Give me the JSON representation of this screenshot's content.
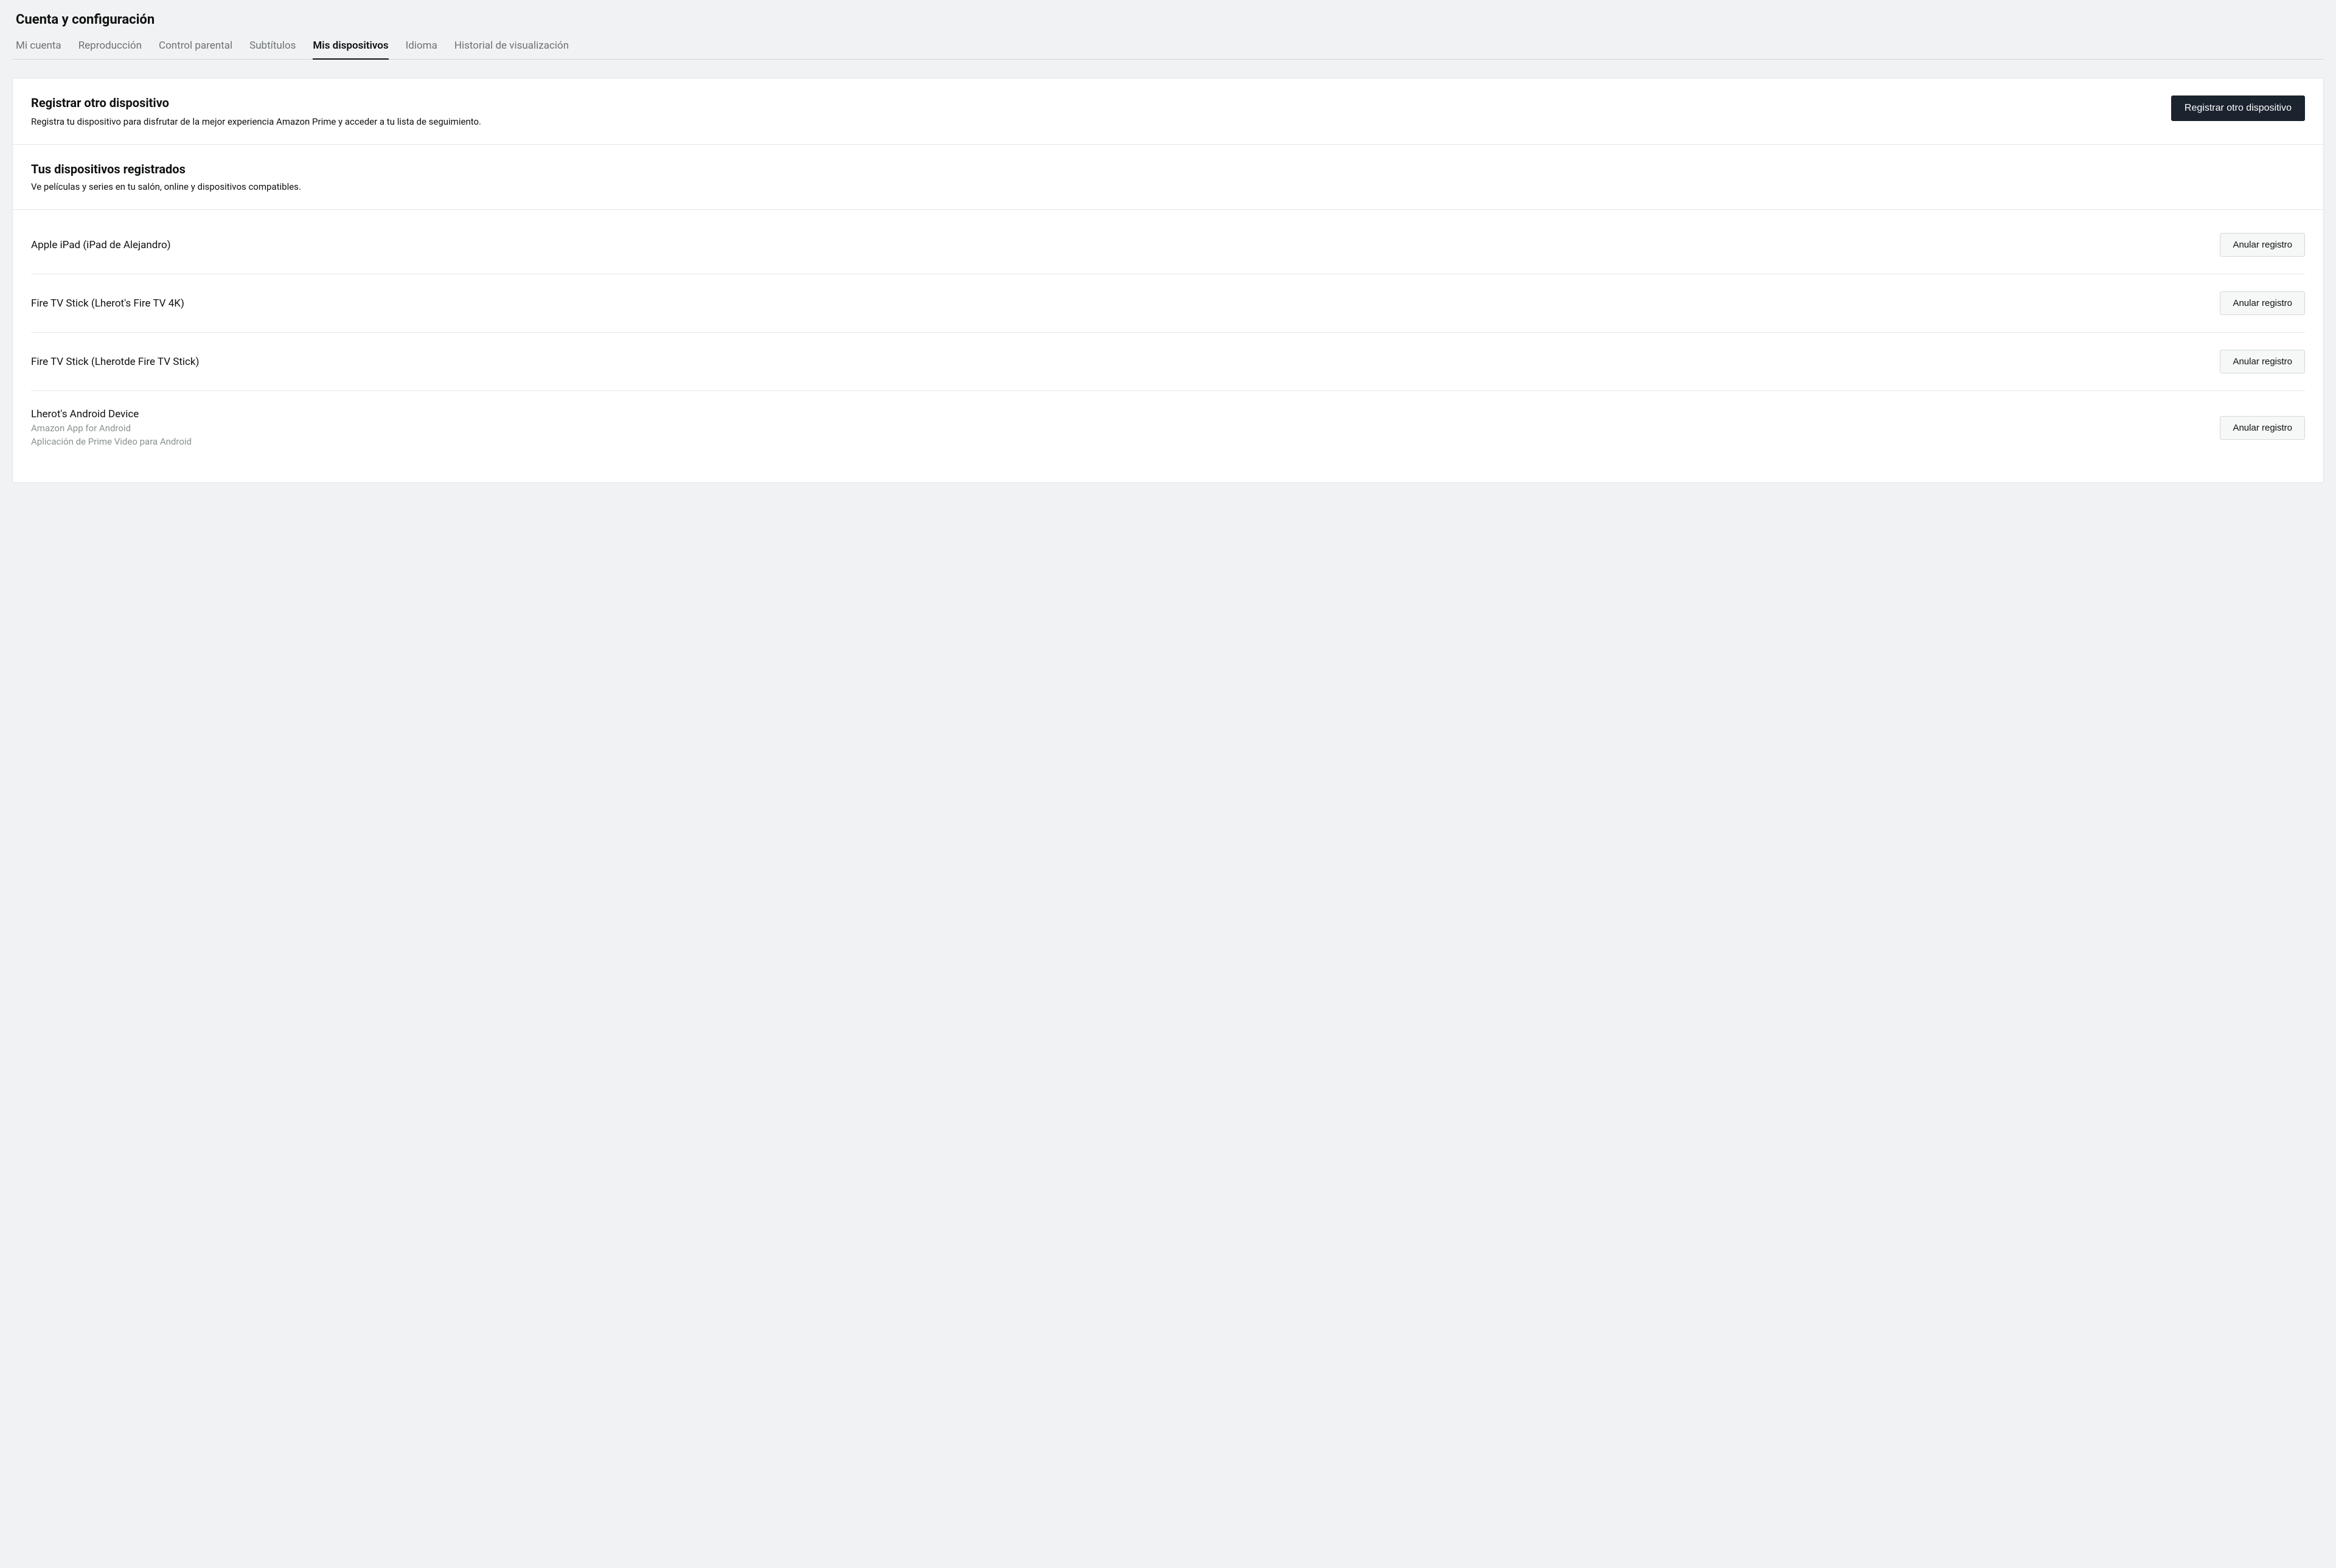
{
  "header": {
    "title": "Cuenta y configuración"
  },
  "tabs": [
    {
      "label": "Mi cuenta",
      "active": false
    },
    {
      "label": "Reproducción",
      "active": false
    },
    {
      "label": "Control parental",
      "active": false
    },
    {
      "label": "Subtítulos",
      "active": false
    },
    {
      "label": "Mis dispositivos",
      "active": true
    },
    {
      "label": "Idioma",
      "active": false
    },
    {
      "label": "Historial de visualización",
      "active": false
    }
  ],
  "register": {
    "title": "Registrar otro dispositivo",
    "description": "Registra tu dispositivo para disfrutar de la mejor experiencia Amazon Prime y acceder a tu lista de seguimiento.",
    "button_label": "Registrar otro dispositivo"
  },
  "registered": {
    "title": "Tus dispositivos registrados",
    "description": "Ve películas y series en tu salón, online y dispositivos compatibles.",
    "unregister_label": "Anular registro",
    "devices": [
      {
        "name": "Apple iPad (iPad de Alejandro)",
        "sublines": []
      },
      {
        "name": "Fire TV Stick (Lherot's Fire TV 4K)",
        "sublines": []
      },
      {
        "name": "Fire TV Stick (Lherotde Fire TV Stick)",
        "sublines": []
      },
      {
        "name": "Lherot's Android Device",
        "sublines": [
          "Amazon App for Android",
          "Aplicación de Prime Video para Android"
        ]
      }
    ]
  }
}
